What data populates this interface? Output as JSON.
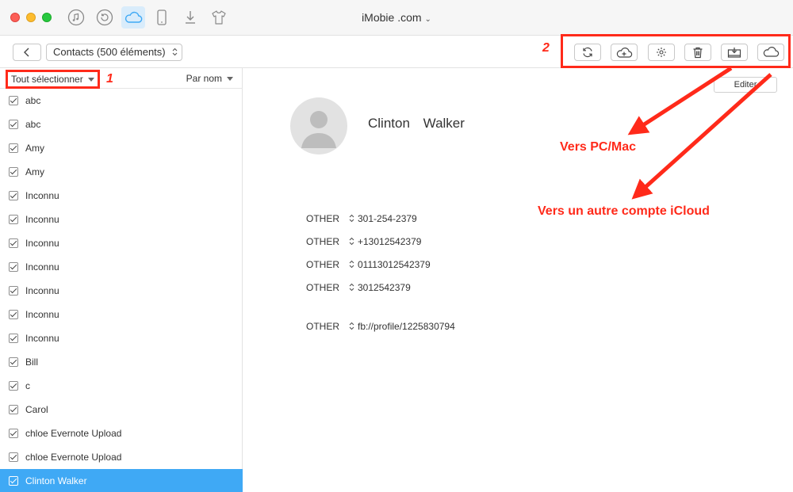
{
  "window": {
    "title": "iMobie .com",
    "title_chevron": "⌄"
  },
  "titlebar_icons": [
    "music-icon",
    "history-icon",
    "icloud-icon",
    "phone-icon",
    "download-icon",
    "shirt-icon"
  ],
  "toolbar": {
    "back_glyph": "‹",
    "contacts_select": "Contacts (500 éléments)",
    "select_arrows": "⌃⌄",
    "annotation_number": "2",
    "actions": [
      "refresh-icon",
      "cloud-upload-icon",
      "settings-icon",
      "trash-icon",
      "export-to-computer-icon",
      "export-to-icloud-icon"
    ]
  },
  "list": {
    "select_all_label": "Tout sélectionner",
    "annotation_number": "1",
    "sort_label": "Par nom",
    "items": [
      {
        "name": "abc",
        "checked": true,
        "selected": false
      },
      {
        "name": "abc",
        "checked": true,
        "selected": false
      },
      {
        "name": "Amy",
        "checked": true,
        "selected": false
      },
      {
        "name": "Amy",
        "checked": true,
        "selected": false
      },
      {
        "name": "Inconnu",
        "checked": true,
        "selected": false
      },
      {
        "name": "Inconnu",
        "checked": true,
        "selected": false
      },
      {
        "name": "Inconnu",
        "checked": true,
        "selected": false
      },
      {
        "name": "Inconnu",
        "checked": true,
        "selected": false
      },
      {
        "name": "Inconnu",
        "checked": true,
        "selected": false
      },
      {
        "name": "Inconnu",
        "checked": true,
        "selected": false
      },
      {
        "name": "Inconnu",
        "checked": true,
        "selected": false
      },
      {
        "name": "Bill",
        "checked": true,
        "selected": false
      },
      {
        "name": "c",
        "checked": true,
        "selected": false
      },
      {
        "name": "Carol",
        "checked": true,
        "selected": false
      },
      {
        "name": "chloe Evernote Upload",
        "checked": true,
        "selected": false
      },
      {
        "name": "chloe Evernote Upload",
        "checked": true,
        "selected": false
      },
      {
        "name": "Clinton Walker",
        "checked": true,
        "selected": true
      }
    ]
  },
  "detail": {
    "edit_label": "Editer",
    "first_name": "Clinton",
    "last_name": "Walker",
    "fields": [
      {
        "label": "OTHER",
        "value": "301-254-2379"
      },
      {
        "label": "OTHER",
        "value": "+13012542379"
      },
      {
        "label": "OTHER",
        "value": "01113012542379"
      },
      {
        "label": "OTHER",
        "value": "3012542379"
      },
      {
        "label": "OTHER",
        "value": "fb://profile/1225830794"
      }
    ]
  },
  "annotations": {
    "to_computer": "Vers PC/Mac",
    "to_icloud": "Vers un autre compte iCloud"
  },
  "colors": {
    "accent": "#3fa9f5",
    "annotation_red": "#ff2a1a"
  }
}
